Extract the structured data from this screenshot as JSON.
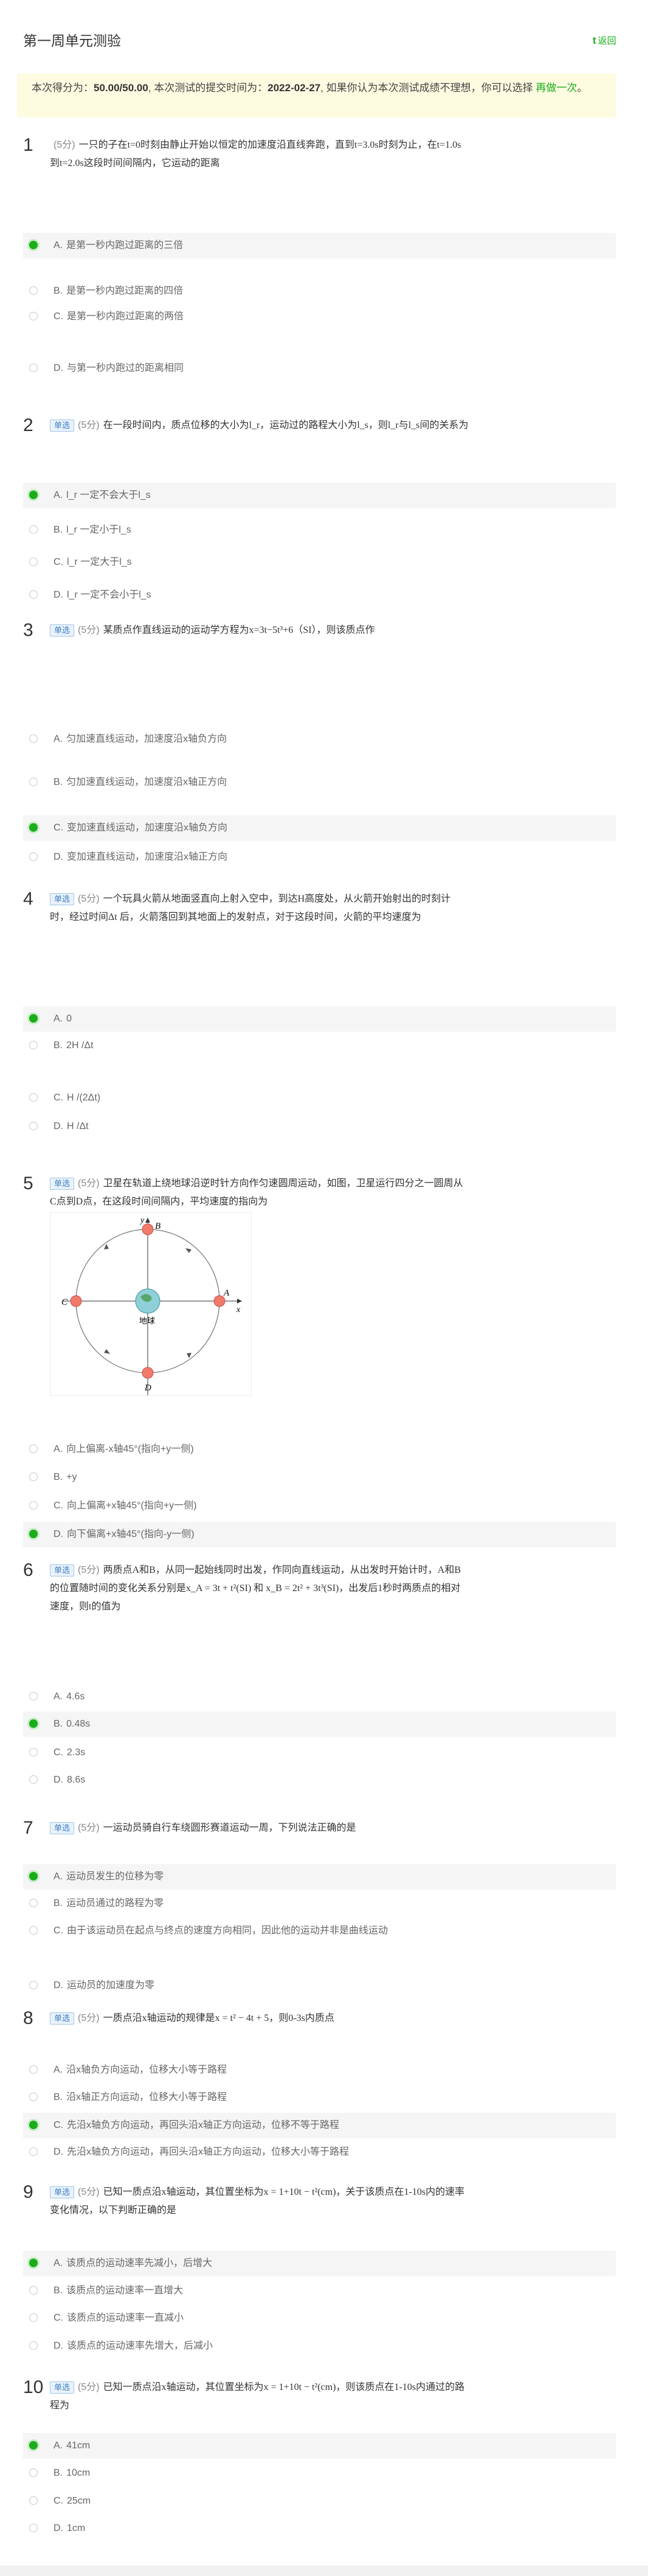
{
  "header": {
    "title": "第一周单元测验",
    "back_label": "返回",
    "back_icon": "t"
  },
  "notice": {
    "part1": "本次得分为：",
    "score": "50.00/50.00",
    "part2": ", 本次测试的提交时间为：",
    "date": "2022-02-27",
    "part3": ", 如果你认为本次测试成绩不理想，你可以选择",
    "retry_link": "再做一次",
    "part4": "。"
  },
  "colors": {
    "accent": "#1aad19",
    "notice_bg": "#fdfbe0",
    "tag_bg": "#e9f2fb"
  },
  "questions": [
    {
      "num": "1",
      "tag": "",
      "score": "(5分)",
      "text": "一只的子在t=0时刻由静止开始以恒定的加速度沿直线奔跑，直到t=3.0s时刻为止，在t=1.0s到t=2.0s这段时间间隔内，它运动的距离",
      "options": [
        {
          "letter": "A.",
          "text": "是第一秒内跑过距离的三倍",
          "selected": true
        },
        {
          "letter": "B.",
          "text": "是第一秒内跑过距离的四倍",
          "selected": false
        },
        {
          "letter": "C.",
          "text": "是第一秒内跑过距离的两倍",
          "selected": false
        },
        {
          "letter": "D.",
          "text": "与第一秒内跑过的距离相同",
          "selected": false
        }
      ]
    },
    {
      "num": "2",
      "tag": "单选",
      "score": "(5分)",
      "text": "在一段时间内，质点位移的大小为l_r，运动过的路程大小为l_s，则l_r与l_s间的关系为",
      "options": [
        {
          "letter": "A.",
          "text": "l_r 一定不会大于l_s",
          "selected": true
        },
        {
          "letter": "B.",
          "text": "l_r 一定小于l_s",
          "selected": false
        },
        {
          "letter": "C.",
          "text": "l_r 一定大于l_s",
          "selected": false
        },
        {
          "letter": "D.",
          "text": "l_r 一定不会小于l_s",
          "selected": false
        }
      ]
    },
    {
      "num": "3",
      "tag": "单选",
      "score": "(5分)",
      "text": "某质点作直线运动的运动学方程为x=3t−5t³+6（SI），则该质点作",
      "options": [
        {
          "letter": "A.",
          "text": "匀加速直线运动，加速度沿x轴负方向",
          "selected": false
        },
        {
          "letter": "B.",
          "text": "匀加速直线运动，加速度沿x轴正方向",
          "selected": false
        },
        {
          "letter": "C.",
          "text": "变加速直线运动，加速度沿x轴负方向",
          "selected": true
        },
        {
          "letter": "D.",
          "text": "变加速直线运动，加速度沿x轴正方向",
          "selected": false
        }
      ]
    },
    {
      "num": "4",
      "tag": "单选",
      "score": "(5分)",
      "text": "一个玩具火箭从地面竖直向上射入空中，到达H高度处，从火箭开始射出的时刻计时，经过时间Δt 后，火箭落回到其地面上的发射点，对于这段时间，火箭的平均速度为",
      "options": [
        {
          "letter": "A.",
          "text": "0",
          "selected": true
        },
        {
          "letter": "B.",
          "text": "2H /Δt",
          "selected": false
        },
        {
          "letter": "C.",
          "text": "H /(2Δt)",
          "selected": false
        },
        {
          "letter": "D.",
          "text": "H /Δt",
          "selected": false
        }
      ]
    },
    {
      "num": "5",
      "tag": "单选",
      "score": "(5分)",
      "text": "卫星在轨道上绕地球沿逆时针方向作匀速圆周运动，如图，卫星运行四分之一圆周从C点到D点，在这段时间间隔内，平均速度的指向为",
      "options": [
        {
          "letter": "A.",
          "text": "向上偏离-x轴45°(指向+y一侧)",
          "selected": false
        },
        {
          "letter": "B.",
          "text": "+y",
          "selected": false
        },
        {
          "letter": "C.",
          "text": "向上偏离+x轴45°(指向+y一侧)",
          "selected": false
        },
        {
          "letter": "D.",
          "text": "向下偏离+x轴45°(指向-y一侧)",
          "selected": true
        }
      ]
    },
    {
      "num": "6",
      "tag": "单选",
      "score": "(5分)",
      "text": "两质点A和B，从同一起始线同时出发，作同向直线运动，从出发时开始计时，A和B的位置随时间的变化关系分别是x_A = 3t + t²(SI) 和 x_B = 2t² + 3t³(SI)，出发后1秒时两质点的相对速度，则t的值为",
      "options": [
        {
          "letter": "A.",
          "text": "4.6s",
          "selected": false
        },
        {
          "letter": "B.",
          "text": "0.48s",
          "selected": true
        },
        {
          "letter": "C.",
          "text": "2.3s",
          "selected": false
        },
        {
          "letter": "D.",
          "text": "8.6s",
          "selected": false
        }
      ]
    },
    {
      "num": "7",
      "tag": "单选",
      "score": "(5分)",
      "text": "一运动员骑自行车绕圆形赛道运动一周，下列说法正确的是",
      "options": [
        {
          "letter": "A.",
          "text": "运动员发生的位移为零",
          "selected": true
        },
        {
          "letter": "B.",
          "text": "运动员通过的路程为零",
          "selected": false
        },
        {
          "letter": "C.",
          "text": "由于该运动员在起点与终点的速度方向相同，因此他的运动并非是曲线运动",
          "selected": false
        },
        {
          "letter": "D.",
          "text": "运动员的加速度为零",
          "selected": false
        }
      ]
    },
    {
      "num": "8",
      "tag": "单选",
      "score": "(5分)",
      "text": "一质点沿x轴运动的规律是x = t² − 4t + 5，则0-3s内质点",
      "options": [
        {
          "letter": "A.",
          "text": "沿x轴负方向运动，位移大小等于路程",
          "selected": false
        },
        {
          "letter": "B.",
          "text": "沿x轴正方向运动，位移大小等于路程",
          "selected": false
        },
        {
          "letter": "C.",
          "text": "先沿x轴负方向运动，再回头沿x轴正方向运动，位移不等于路程",
          "selected": true
        },
        {
          "letter": "D.",
          "text": "先沿x轴负方向运动，再回头沿x轴正方向运动，位移大小等于路程",
          "selected": false
        }
      ]
    },
    {
      "num": "9",
      "tag": "单选",
      "score": "(5分)",
      "text": "已知一质点沿x轴运动，其位置坐标为x = 1+10t − t²(cm)，关于该质点在1-10s内的速率变化情况，以下判断正确的是",
      "options": [
        {
          "letter": "A.",
          "text": "该质点的运动速率先减小，后增大",
          "selected": true
        },
        {
          "letter": "B.",
          "text": "该质点的运动速率一直增大",
          "selected": false
        },
        {
          "letter": "C.",
          "text": "该质点的运动速率一直减小",
          "selected": false
        },
        {
          "letter": "D.",
          "text": "该质点的运动速率先增大，后减小",
          "selected": false
        }
      ]
    },
    {
      "num": "10",
      "tag": "单选",
      "score": "(5分)",
      "text": "已知一质点沿x轴运动，其位置坐标为x = 1+10t − t²(cm)，则该质点在1-10s内通过的路程为",
      "options": [
        {
          "letter": "A.",
          "text": "41cm",
          "selected": true
        },
        {
          "letter": "B.",
          "text": "10cm",
          "selected": false
        },
        {
          "letter": "C.",
          "text": "25cm",
          "selected": false
        },
        {
          "letter": "D.",
          "text": "1cm",
          "selected": false
        }
      ]
    }
  ],
  "figure": {
    "labels": {
      "y": "y",
      "x": "x",
      "A": "A",
      "B": "B",
      "C": "C",
      "D": "D",
      "earth": "地球"
    }
  }
}
